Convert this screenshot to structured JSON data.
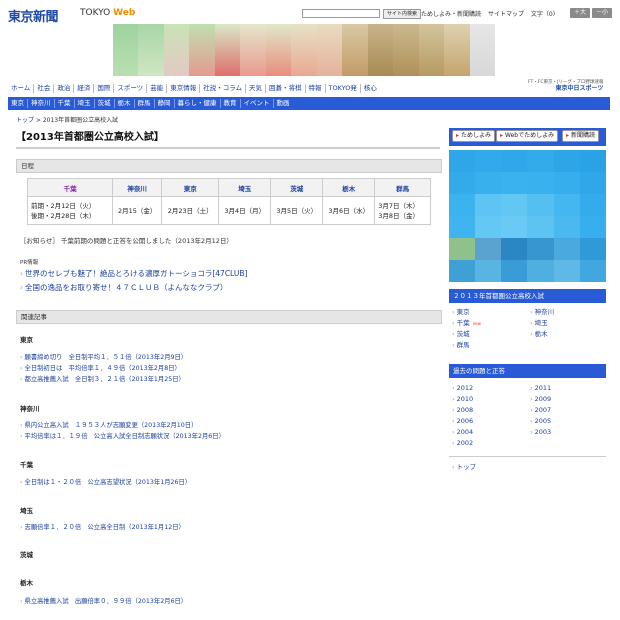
{
  "header": {
    "logo": "東京新聞",
    "logo_sub_plain": "TOKYO ",
    "logo_sub_accent": "Web",
    "search_button": "サイト内検索",
    "links": [
      "ためしよみ・新聞購読",
      "サイトマップ"
    ],
    "font_label": "文字（0）",
    "font_up": "＋大",
    "font_down": "－小"
  },
  "nav1": [
    "ホーム",
    "社会",
    "政治",
    "経済",
    "国際",
    "スポーツ",
    "芸能",
    "東京情報",
    "社説・コラム",
    "天気",
    "囲碁・将棋",
    "特報",
    "TOKYO発",
    "核心"
  ],
  "sponsor": {
    "line1": "FT・FC東京・Jリーグ・プロ野球速報",
    "line2": "東京中日スポーツ"
  },
  "nav2": [
    "東京",
    "神奈川",
    "千葉",
    "埼玉",
    "茨城",
    "栃木",
    "群馬",
    "静岡",
    "暮らし・健康",
    "教育",
    "イベント",
    "動画"
  ],
  "breadcrumb": {
    "top": "トップ",
    "current": "2013年首都圏公立高校入試"
  },
  "page_title": "【2013年首都圏公立高校入試】",
  "schedule": {
    "heading": "日程",
    "columns": [
      "千葉",
      "神奈川",
      "東京",
      "埼玉",
      "茨城",
      "栃木",
      "群馬"
    ],
    "cells": [
      "前期・2月12日（火）\n後期・2月28日（木）",
      "2月15（金）",
      "2月23日（土）",
      "3月4日（月）",
      "3月5日（火）",
      "3月6日（水）",
      "3月7日（木）\n3月8日（金）"
    ]
  },
  "notice": "［お知らせ］ 千葉前期の問題と正答を公開しました（2013年2月12日）",
  "pr": {
    "label": "PR情報",
    "links": [
      "世界のセレブも魅了！絶品とろける濃厚ガトーショコラ[47CLUB]",
      "全国の逸品をお取り寄せ！４７ＣＬＵＢ（よんななクラブ）"
    ]
  },
  "related": {
    "heading": "関連記事",
    "groups": [
      {
        "region": "東京",
        "items": [
          "願書締め切り　全日制平均１．５１倍（2013年2月9日）",
          "全日制初日は　平均倍率１．４９倍（2013年2月8日）",
          "都立高推薦入試　全日制３．２１倍（2013年1月25日）"
        ]
      },
      {
        "region": "神奈川",
        "items": [
          "県内公立高入試　１９５３人が志願変更（2013年2月10日）",
          "平均倍率は１．１９倍　公立高入試全日制志願状況（2013年2月6日）"
        ]
      },
      {
        "region": "千葉",
        "items": [
          "全日制は１・２０倍　公立高志望状況（2013年1月26日）"
        ]
      },
      {
        "region": "埼玉",
        "items": [
          "志願倍率１．２０倍　公立高全日制（2013年1月12日）"
        ]
      },
      {
        "region": "茨城",
        "items": []
      },
      {
        "region": "栃木",
        "items": [
          "県立高推薦入試　出願倍率０．９９倍（2013年2月6日）"
        ]
      }
    ]
  },
  "sidebar": {
    "buttons": [
      "ためしよみ",
      "Webでためしよみ",
      "新聞購読"
    ],
    "section1": {
      "heading": "２０１３年首都圏公立高校入試",
      "left": [
        "東京",
        "千葉",
        "茨城",
        "群馬"
      ],
      "right": [
        "神奈川",
        "埼玉",
        "栃木"
      ],
      "new_badge": "new"
    },
    "section2": {
      "heading": "過去の問題と正答",
      "left": [
        "2012",
        "2010",
        "2008",
        "2006",
        "2004",
        "2002"
      ],
      "right": [
        "2011",
        "2009",
        "2007",
        "2005",
        "2003"
      ]
    },
    "top_link": "トップ"
  },
  "colors": {
    "nav_blue": "#2a5bd7",
    "link": "#1a3ea0",
    "accent_orange": "#f18b00"
  }
}
